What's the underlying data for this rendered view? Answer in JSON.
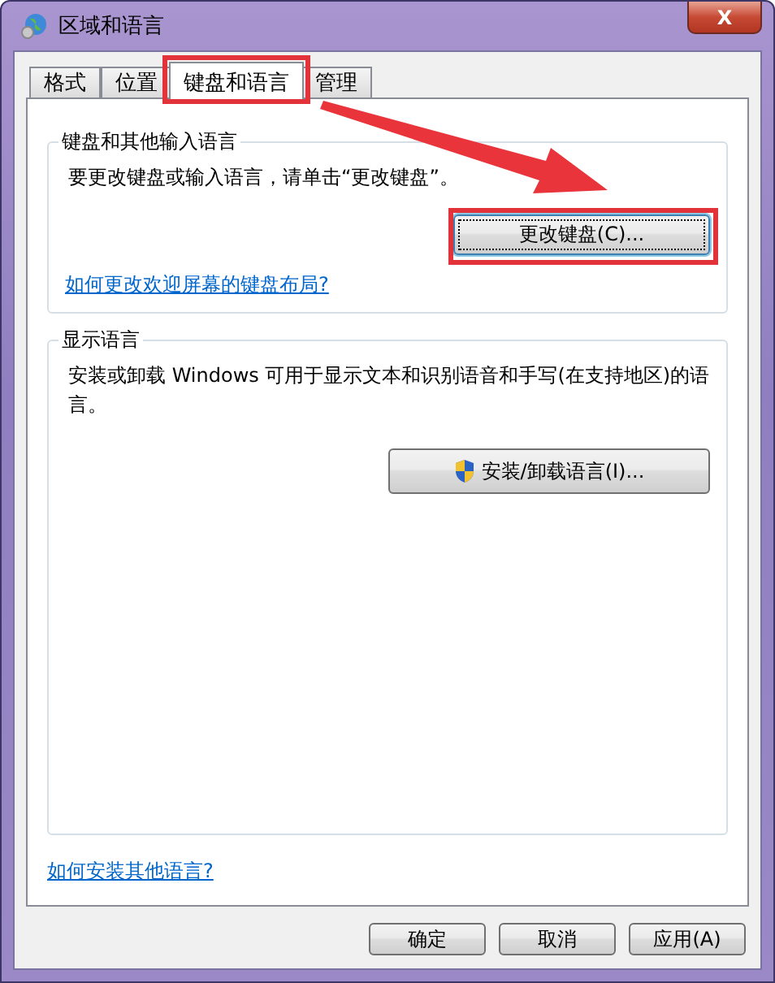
{
  "window": {
    "title": "区域和语言",
    "close_label": "X"
  },
  "tabs": [
    {
      "label": "格式",
      "selected": false,
      "highlighted": false
    },
    {
      "label": "位置",
      "selected": false,
      "highlighted": false
    },
    {
      "label": "键盘和语言",
      "selected": true,
      "highlighted": true
    },
    {
      "label": "管理",
      "selected": false,
      "highlighted": false
    }
  ],
  "arrow": true,
  "keyboard_group": {
    "title": "键盘和其他输入语言",
    "text": "要更改键盘或输入语言，请单击“更改键盘”。",
    "button": {
      "label": "更改键盘(C)...",
      "focused": true,
      "highlighted": true
    },
    "link": "如何更改欢迎屏幕的键盘布局?"
  },
  "display_group": {
    "title": "显示语言",
    "text": "安装或卸载 Windows 可用于显示文本和识别语音和手写(在支持地区)的语言。",
    "button": {
      "label": "安装/卸载语言(I)...",
      "shield": true
    }
  },
  "footer_link": "如何安装其他语言?",
  "buttons": [
    "确定",
    "取消",
    "应用(A)"
  ]
}
